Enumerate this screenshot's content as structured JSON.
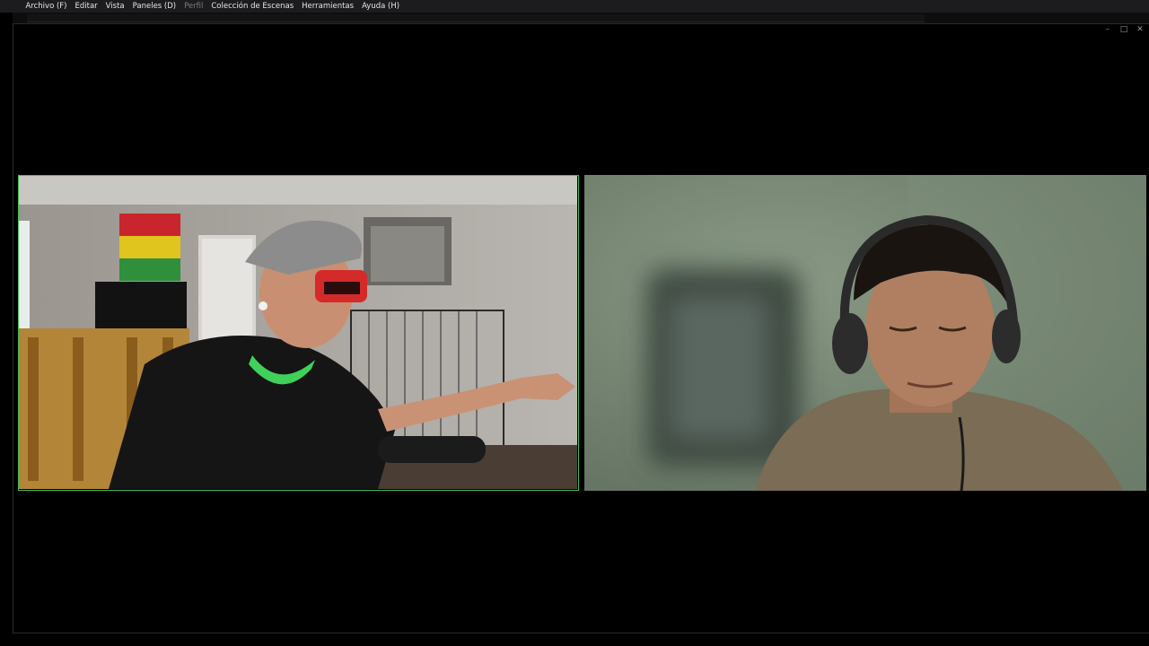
{
  "menu": {
    "items": [
      {
        "label": "Archivo (F)",
        "enabled": true
      },
      {
        "label": "Editar",
        "enabled": true
      },
      {
        "label": "Vista",
        "enabled": true
      },
      {
        "label": "Paneles (D)",
        "enabled": true
      },
      {
        "label": "Perfil",
        "enabled": false
      },
      {
        "label": "Colección de Escenas",
        "enabled": true
      },
      {
        "label": "Herramientas",
        "enabled": true
      },
      {
        "label": "Ayuda (H)",
        "enabled": true
      }
    ]
  },
  "window_controls": {
    "minimize": "–",
    "maximize": "□",
    "close": "✕"
  },
  "video": {
    "left_tile": {
      "active_speaker": true,
      "border_color": "#3fbf5a"
    },
    "right_tile": {
      "active_speaker": false
    }
  },
  "colors": {
    "menubar_bg": "#1c1c1e",
    "canvas_bg": "#000000",
    "active_border": "#3fbf5a"
  }
}
